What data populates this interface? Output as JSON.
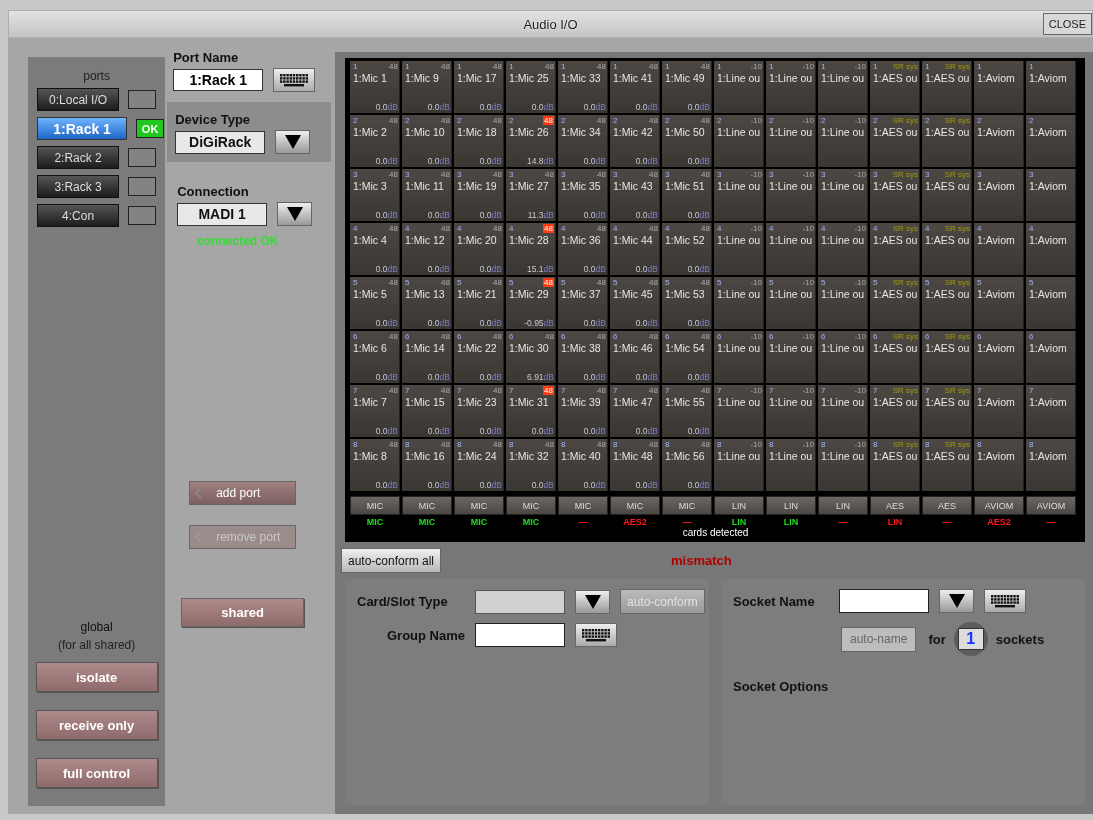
{
  "window": {
    "title": "Audio I/O",
    "close": "CLOSE"
  },
  "ports": {
    "heading": "ports",
    "items": [
      {
        "label": "0:Local I/O",
        "selected": false,
        "connected": false
      },
      {
        "label": "1:Rack 1",
        "selected": true,
        "connected": true,
        "status": "OK"
      },
      {
        "label": "2:Rack 2",
        "selected": false,
        "connected": false
      },
      {
        "label": "3:Rack 3",
        "selected": false,
        "connected": false
      },
      {
        "label": "4:Con",
        "selected": false,
        "connected": false
      }
    ],
    "global_title": "global",
    "global_note": "(for all shared)",
    "buttons": [
      "isolate",
      "receive only",
      "full control"
    ]
  },
  "port_form": {
    "port_name_label": "Port Name",
    "port_name": "1:Rack 1",
    "device_type_label": "Device Type",
    "device_type": "DiGiRack",
    "connection_label": "Connection",
    "connection": "MADI 1",
    "connection_status": "connected OK",
    "add_port": {
      "label": "add port",
      "disabled": false
    },
    "remove_port": {
      "label": "remove port",
      "disabled": true
    },
    "shared": "shared"
  },
  "grid": {
    "columns": [
      {
        "kind": "mic",
        "card": "MIC",
        "status": "MIC",
        "ok": true,
        "cells": [
          {
            "n": "1",
            "tag": "48",
            "phantom": false,
            "name": "1:Mic 1",
            "gain": "0.0",
            "unit": "dB"
          },
          {
            "n": "2",
            "tag": "48",
            "phantom": false,
            "name": "1:Mic 2",
            "gain": "0.0",
            "unit": "dB"
          },
          {
            "n": "3",
            "tag": "48",
            "phantom": false,
            "name": "1:Mic 3",
            "gain": "0.0",
            "unit": "dB"
          },
          {
            "n": "4",
            "tag": "48",
            "phantom": false,
            "name": "1:Mic 4",
            "gain": "0.0",
            "unit": "dB"
          },
          {
            "n": "5",
            "tag": "48",
            "phantom": false,
            "name": "1:Mic 5",
            "gain": "0.0",
            "unit": "dB"
          },
          {
            "n": "6",
            "tag": "48",
            "phantom": false,
            "name": "1:Mic 6",
            "gain": "0.0",
            "unit": "dB"
          },
          {
            "n": "7",
            "tag": "48",
            "phantom": false,
            "name": "1:Mic 7",
            "gain": "0.0",
            "unit": "dB"
          },
          {
            "n": "8",
            "tag": "48",
            "phantom": false,
            "name": "1:Mic 8",
            "gain": "0.0",
            "unit": "dB"
          }
        ]
      },
      {
        "kind": "mic",
        "card": "MIC",
        "status": "MIC",
        "ok": true,
        "cells": [
          {
            "n": "1",
            "tag": "48",
            "phantom": false,
            "name": "1:Mic 9",
            "gain": "0.0",
            "unit": "dB"
          },
          {
            "n": "2",
            "tag": "48",
            "phantom": false,
            "name": "1:Mic 10",
            "gain": "0.0",
            "unit": "dB"
          },
          {
            "n": "3",
            "tag": "48",
            "phantom": false,
            "name": "1:Mic 11",
            "gain": "0.0",
            "unit": "dB"
          },
          {
            "n": "4",
            "tag": "48",
            "phantom": false,
            "name": "1:Mic 12",
            "gain": "0.0",
            "unit": "dB"
          },
          {
            "n": "5",
            "tag": "48",
            "phantom": false,
            "name": "1:Mic 13",
            "gain": "0.0",
            "unit": "dB"
          },
          {
            "n": "6",
            "tag": "48",
            "phantom": false,
            "name": "1:Mic 14",
            "gain": "0.0",
            "unit": "dB"
          },
          {
            "n": "7",
            "tag": "48",
            "phantom": false,
            "name": "1:Mic 15",
            "gain": "0.0",
            "unit": "dB"
          },
          {
            "n": "8",
            "tag": "48",
            "phantom": false,
            "name": "1:Mic 16",
            "gain": "0.0",
            "unit": "dB"
          }
        ]
      },
      {
        "kind": "mic",
        "card": "MIC",
        "status": "MIC",
        "ok": true,
        "cells": [
          {
            "n": "1",
            "tag": "48",
            "phantom": false,
            "name": "1:Mic 17",
            "gain": "0.0",
            "unit": "dB"
          },
          {
            "n": "2",
            "tag": "48",
            "phantom": false,
            "name": "1:Mic 18",
            "gain": "0.0",
            "unit": "dB"
          },
          {
            "n": "3",
            "tag": "48",
            "phantom": false,
            "name": "1:Mic 19",
            "gain": "0.0",
            "unit": "dB"
          },
          {
            "n": "4",
            "tag": "48",
            "phantom": false,
            "name": "1:Mic 20",
            "gain": "0.0",
            "unit": "dB"
          },
          {
            "n": "5",
            "tag": "48",
            "phantom": false,
            "name": "1:Mic 21",
            "gain": "0.0",
            "unit": "dB"
          },
          {
            "n": "6",
            "tag": "48",
            "phantom": false,
            "name": "1:Mic 22",
            "gain": "0.0",
            "unit": "dB"
          },
          {
            "n": "7",
            "tag": "48",
            "phantom": false,
            "name": "1:Mic 23",
            "gain": "0.0",
            "unit": "dB"
          },
          {
            "n": "8",
            "tag": "48",
            "phantom": false,
            "name": "1:Mic 24",
            "gain": "0.0",
            "unit": "dB"
          }
        ]
      },
      {
        "kind": "mic",
        "card": "MIC",
        "status": "MIC",
        "ok": true,
        "cells": [
          {
            "n": "1",
            "tag": "48",
            "phantom": false,
            "name": "1:Mic 25",
            "gain": "0.0",
            "unit": "dB"
          },
          {
            "n": "2",
            "tag": "48",
            "phantom": true,
            "name": "1:Mic 26",
            "gain": "14.8",
            "unit": "dB"
          },
          {
            "n": "3",
            "tag": "48",
            "phantom": false,
            "name": "1:Mic 27",
            "gain": "11.3",
            "unit": "dB"
          },
          {
            "n": "4",
            "tag": "48",
            "phantom": true,
            "name": "1:Mic 28",
            "gain": "15.1",
            "unit": "dB"
          },
          {
            "n": "5",
            "tag": "48",
            "phantom": true,
            "name": "1:Mic 29",
            "gain": "-0.95",
            "unit": "dB"
          },
          {
            "n": "6",
            "tag": "48",
            "phantom": false,
            "name": "1:Mic 30",
            "gain": "6.91",
            "unit": "dB"
          },
          {
            "n": "7",
            "tag": "48",
            "phantom": true,
            "name": "1:Mic 31",
            "gain": "0.0",
            "unit": "dB"
          },
          {
            "n": "8",
            "tag": "48",
            "phantom": false,
            "name": "1:Mic 32",
            "gain": "0.0",
            "unit": "dB"
          }
        ]
      },
      {
        "kind": "mic",
        "card": "MIC",
        "status": "—",
        "ok": false,
        "cells": [
          {
            "n": "1",
            "tag": "48",
            "phantom": false,
            "name": "1:Mic 33",
            "gain": "0.0",
            "unit": "dB"
          },
          {
            "n": "2",
            "tag": "48",
            "phantom": false,
            "name": "1:Mic 34",
            "gain": "0.0",
            "unit": "dB"
          },
          {
            "n": "3",
            "tag": "48",
            "phantom": false,
            "name": "1:Mic 35",
            "gain": "0.0",
            "unit": "dB"
          },
          {
            "n": "4",
            "tag": "48",
            "phantom": false,
            "name": "1:Mic 36",
            "gain": "0.0",
            "unit": "dB"
          },
          {
            "n": "5",
            "tag": "48",
            "phantom": false,
            "name": "1:Mic 37",
            "gain": "0.0",
            "unit": "dB"
          },
          {
            "n": "6",
            "tag": "48",
            "phantom": false,
            "name": "1:Mic 38",
            "gain": "0.0",
            "unit": "dB"
          },
          {
            "n": "7",
            "tag": "48",
            "phantom": false,
            "name": "1:Mic 39",
            "gain": "0.0",
            "unit": "dB"
          },
          {
            "n": "8",
            "tag": "48",
            "phantom": false,
            "name": "1:Mic 40",
            "gain": "0.0",
            "unit": "dB"
          }
        ]
      },
      {
        "kind": "mic",
        "card": "MIC",
        "status": "AES2",
        "ok": false,
        "cells": [
          {
            "n": "1",
            "tag": "48",
            "phantom": false,
            "name": "1:Mic 41",
            "gain": "0.0",
            "unit": "dB"
          },
          {
            "n": "2",
            "tag": "48",
            "phantom": false,
            "name": "1:Mic 42",
            "gain": "0.0",
            "unit": "dB"
          },
          {
            "n": "3",
            "tag": "48",
            "phantom": false,
            "name": "1:Mic 43",
            "gain": "0.0",
            "unit": "dB"
          },
          {
            "n": "4",
            "tag": "48",
            "phantom": false,
            "name": "1:Mic 44",
            "gain": "0.0",
            "unit": "dB"
          },
          {
            "n": "5",
            "tag": "48",
            "phantom": false,
            "name": "1:Mic 45",
            "gain": "0.0",
            "unit": "dB"
          },
          {
            "n": "6",
            "tag": "48",
            "phantom": false,
            "name": "1:Mic 46",
            "gain": "0.0",
            "unit": "dB"
          },
          {
            "n": "7",
            "tag": "48",
            "phantom": false,
            "name": "1:Mic 47",
            "gain": "0.0",
            "unit": "dB"
          },
          {
            "n": "8",
            "tag": "48",
            "phantom": false,
            "name": "1:Mic 48",
            "gain": "0.0",
            "unit": "dB"
          }
        ]
      },
      {
        "kind": "mic",
        "card": "MIC",
        "status": "—",
        "ok": false,
        "cells": [
          {
            "n": "1",
            "tag": "48",
            "phantom": false,
            "name": "1:Mic 49",
            "gain": "0.0",
            "unit": "dB"
          },
          {
            "n": "2",
            "tag": "48",
            "phantom": false,
            "name": "1:Mic 50",
            "gain": "0.0",
            "unit": "dB"
          },
          {
            "n": "3",
            "tag": "48",
            "phantom": false,
            "name": "1:Mic 51",
            "gain": "0.0",
            "unit": "dB"
          },
          {
            "n": "4",
            "tag": "48",
            "phantom": false,
            "name": "1:Mic 52",
            "gain": "0.0",
            "unit": "dB"
          },
          {
            "n": "5",
            "tag": "48",
            "phantom": false,
            "name": "1:Mic 53",
            "gain": "0.0",
            "unit": "dB"
          },
          {
            "n": "6",
            "tag": "48",
            "phantom": false,
            "name": "1:Mic 54",
            "gain": "0.0",
            "unit": "dB"
          },
          {
            "n": "7",
            "tag": "48",
            "phantom": false,
            "name": "1:Mic 55",
            "gain": "0.0",
            "unit": "dB"
          },
          {
            "n": "8",
            "tag": "48",
            "phantom": false,
            "name": "1:Mic 56",
            "gain": "0.0",
            "unit": "dB"
          }
        ]
      },
      {
        "kind": "line",
        "card": "LIN",
        "status": "LIN",
        "ok": true,
        "cells": [
          {
            "n": "1",
            "tag": "-10",
            "name": "1:Line ou"
          },
          {
            "n": "2",
            "tag": "-10",
            "name": "1:Line ou"
          },
          {
            "n": "3",
            "tag": "-10",
            "name": "1:Line ou"
          },
          {
            "n": "4",
            "tag": "-10",
            "name": "1:Line ou"
          },
          {
            "n": "5",
            "tag": "-10",
            "name": "1:Line ou"
          },
          {
            "n": "6",
            "tag": "-10",
            "name": "1:Line ou"
          },
          {
            "n": "7",
            "tag": "-10",
            "name": "1:Line ou"
          },
          {
            "n": "8",
            "tag": "-10",
            "name": "1:Line ou"
          }
        ]
      },
      {
        "kind": "line",
        "card": "LIN",
        "status": "LIN",
        "ok": true,
        "cells": [
          {
            "n": "1",
            "tag": "-10",
            "name": "1:Line ou"
          },
          {
            "n": "2",
            "tag": "-10",
            "name": "1:Line ou"
          },
          {
            "n": "3",
            "tag": "-10",
            "name": "1:Line ou"
          },
          {
            "n": "4",
            "tag": "-10",
            "name": "1:Line ou"
          },
          {
            "n": "5",
            "tag": "-10",
            "name": "1:Line ou"
          },
          {
            "n": "6",
            "tag": "-10",
            "name": "1:Line ou"
          },
          {
            "n": "7",
            "tag": "-10",
            "name": "1:Line ou"
          },
          {
            "n": "8",
            "tag": "-10",
            "name": "1:Line ou"
          }
        ]
      },
      {
        "kind": "line",
        "card": "LIN",
        "status": "—",
        "ok": false,
        "cells": [
          {
            "n": "1",
            "tag": "-10",
            "name": "1:Line ou"
          },
          {
            "n": "2",
            "tag": "-10",
            "name": "1:Line ou"
          },
          {
            "n": "3",
            "tag": "-10",
            "name": "1:Line ou"
          },
          {
            "n": "4",
            "tag": "-10",
            "name": "1:Line ou"
          },
          {
            "n": "5",
            "tag": "-10",
            "name": "1:Line ou"
          },
          {
            "n": "6",
            "tag": "-10",
            "name": "1:Line ou"
          },
          {
            "n": "7",
            "tag": "-10",
            "name": "1:Line ou"
          },
          {
            "n": "8",
            "tag": "-10",
            "name": "1:Line ou"
          }
        ]
      },
      {
        "kind": "aes",
        "card": "AES",
        "status": "LIN",
        "ok": false,
        "cells": [
          {
            "n": "1",
            "tag": "SR sys",
            "name": "1:AES ou"
          },
          {
            "n": "2",
            "tag": "SR sys",
            "name": "1:AES ou"
          },
          {
            "n": "3",
            "tag": "SR sys",
            "name": "1:AES ou"
          },
          {
            "n": "4",
            "tag": "SR sys",
            "name": "1:AES ou"
          },
          {
            "n": "5",
            "tag": "SR sys",
            "name": "1:AES ou"
          },
          {
            "n": "6",
            "tag": "SR sys",
            "name": "1:AES ou"
          },
          {
            "n": "7",
            "tag": "SR sys",
            "name": "1:AES ou"
          },
          {
            "n": "8",
            "tag": "SR sys",
            "name": "1:AES ou"
          }
        ]
      },
      {
        "kind": "aes",
        "card": "AES",
        "status": "—",
        "ok": false,
        "cells": [
          {
            "n": "1",
            "tag": "SR sys",
            "name": "1:AES ou"
          },
          {
            "n": "2",
            "tag": "SR sys",
            "name": "1:AES ou"
          },
          {
            "n": "3",
            "tag": "SR sys",
            "name": "1:AES ou"
          },
          {
            "n": "4",
            "tag": "SR sys",
            "name": "1:AES ou"
          },
          {
            "n": "5",
            "tag": "SR sys",
            "name": "1:AES ou"
          },
          {
            "n": "6",
            "tag": "SR sys",
            "name": "1:AES ou"
          },
          {
            "n": "7",
            "tag": "SR sys",
            "name": "1:AES ou"
          },
          {
            "n": "8",
            "tag": "SR sys",
            "name": "1:AES ou"
          }
        ]
      },
      {
        "kind": "aviom",
        "card": "AVIOM",
        "status": "AES2",
        "ok": false,
        "cells": [
          {
            "n": "1",
            "name": "1:Aviom"
          },
          {
            "n": "2",
            "name": "1:Aviom"
          },
          {
            "n": "3",
            "name": "1:Aviom"
          },
          {
            "n": "4",
            "name": "1:Aviom"
          },
          {
            "n": "5",
            "name": "1:Aviom"
          },
          {
            "n": "6",
            "name": "1:Aviom"
          },
          {
            "n": "7",
            "name": "1:Aviom"
          },
          {
            "n": "8",
            "name": "1:Aviom"
          }
        ]
      },
      {
        "kind": "aviom",
        "card": "AVIOM",
        "status": "—",
        "ok": false,
        "cells": [
          {
            "n": "1",
            "name": "1:Aviom"
          },
          {
            "n": "2",
            "name": "1:Aviom"
          },
          {
            "n": "3",
            "name": "1:Aviom"
          },
          {
            "n": "4",
            "name": "1:Aviom"
          },
          {
            "n": "5",
            "name": "1:Aviom"
          },
          {
            "n": "6",
            "name": "1:Aviom"
          },
          {
            "n": "7",
            "name": "1:Aviom"
          },
          {
            "n": "8",
            "name": "1:Aviom"
          }
        ]
      }
    ],
    "footer": "cards detected"
  },
  "auto_conform_all": "auto-conform all",
  "mismatch": "mismatch",
  "card_panel": {
    "card_slot_label": "Card/Slot Type",
    "auto_conform": {
      "label": "auto-conform",
      "disabled": true
    },
    "group_name_label": "Group Name"
  },
  "socket_panel": {
    "socket_name_label": "Socket Name",
    "auto_name": {
      "label": "auto-name",
      "disabled": true
    },
    "for_label": "for",
    "socket_count": "1",
    "sockets_label": "sockets",
    "options_label": "Socket Options"
  }
}
